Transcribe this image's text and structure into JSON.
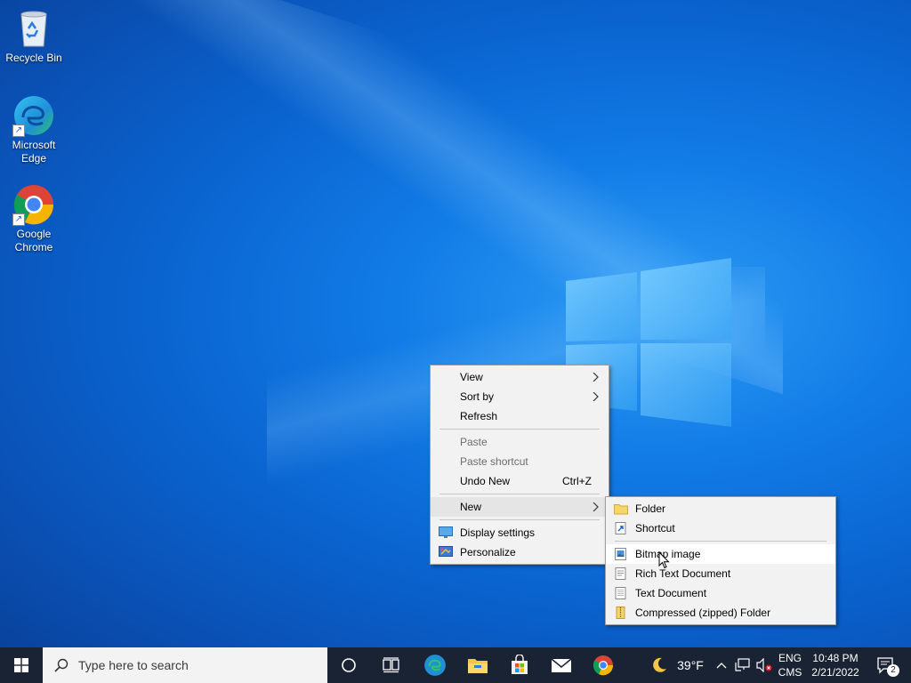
{
  "desktop": {
    "icons": [
      {
        "label": "Recycle Bin"
      },
      {
        "label": "Microsoft Edge"
      },
      {
        "label": "Google Chrome"
      }
    ]
  },
  "context_menu": {
    "items": {
      "view": "View",
      "sort_by": "Sort by",
      "refresh": "Refresh",
      "paste": "Paste",
      "paste_shortcut": "Paste shortcut",
      "undo_new": "Undo New",
      "undo_new_shortcut": "Ctrl+Z",
      "new": "New",
      "display_settings": "Display settings",
      "personalize": "Personalize"
    }
  },
  "new_submenu": {
    "items": {
      "folder": "Folder",
      "shortcut": "Shortcut",
      "bitmap_image": "Bitmap image",
      "rich_text_document": "Rich Text Document",
      "text_document": "Text Document",
      "compressed_folder": "Compressed (zipped) Folder"
    }
  },
  "taskbar": {
    "search_placeholder": "Type here to search",
    "weather_temp": "39°F",
    "language_top": "ENG",
    "language_bottom": "CMS",
    "time": "10:48 PM",
    "date": "2/21/2022",
    "notification_count": "2"
  },
  "colors": {
    "taskbar_bg": "#1a2333",
    "menu_bg": "#f2f2f2",
    "desktop_accent": "#0a63cf"
  }
}
